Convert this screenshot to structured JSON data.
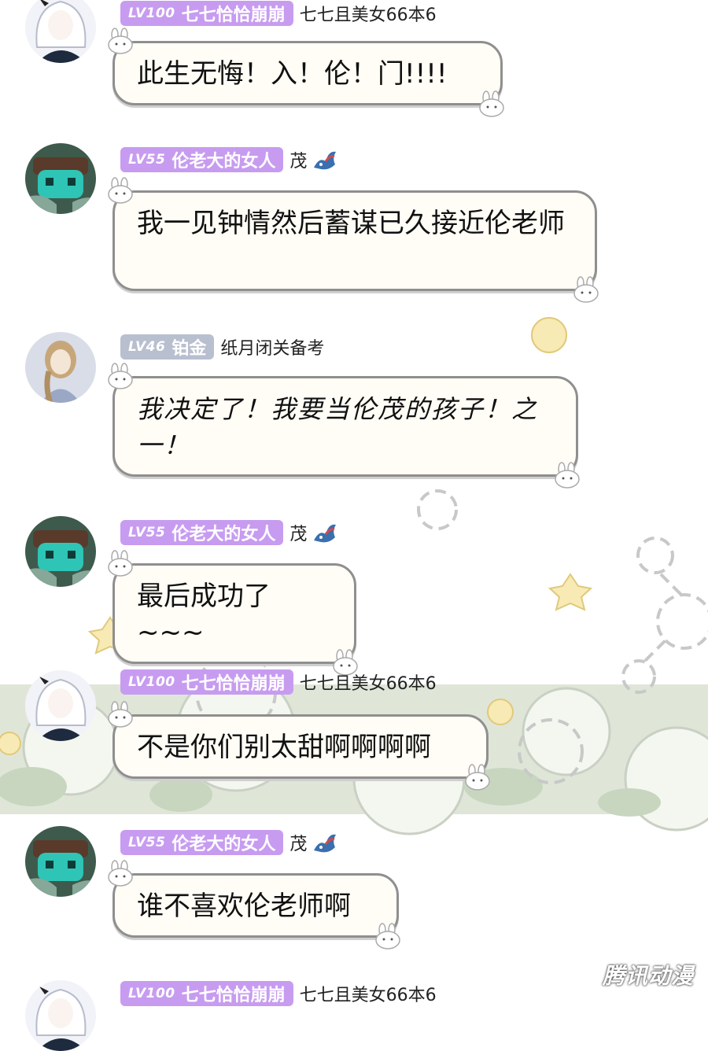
{
  "users": {
    "qiqi": {
      "level": "LV100",
      "name": "七七恰恰崩崩",
      "title": "七七且美女66本6"
    },
    "lun": {
      "level": "LV55",
      "name": "伦老大的女人",
      "title": "茂"
    },
    "zhiyue": {
      "level": "LV46",
      "name": "铂金",
      "title": "纸月闭关备考"
    }
  },
  "messages": [
    {
      "user": "qiqi",
      "text": "此生无悔！入！伦！门!!!!"
    },
    {
      "user": "lun",
      "text": "我一见钟情然后蓄谋已久接近伦老师"
    },
    {
      "user": "zhiyue",
      "text": "我决定了！我要当伦茂的孩子！之一！"
    },
    {
      "user": "lun",
      "text": "最后成功了~~~"
    },
    {
      "user": "qiqi",
      "text": "不是你们别太甜啊啊啊啊"
    },
    {
      "user": "lun",
      "text": "谁不喜欢伦老师啊"
    },
    {
      "user": "qiqi",
      "text": ""
    }
  ],
  "badge_colors": {
    "purple": "#c79cf0",
    "gray": "#b8bfcf"
  },
  "watermark": "腾讯动漫"
}
